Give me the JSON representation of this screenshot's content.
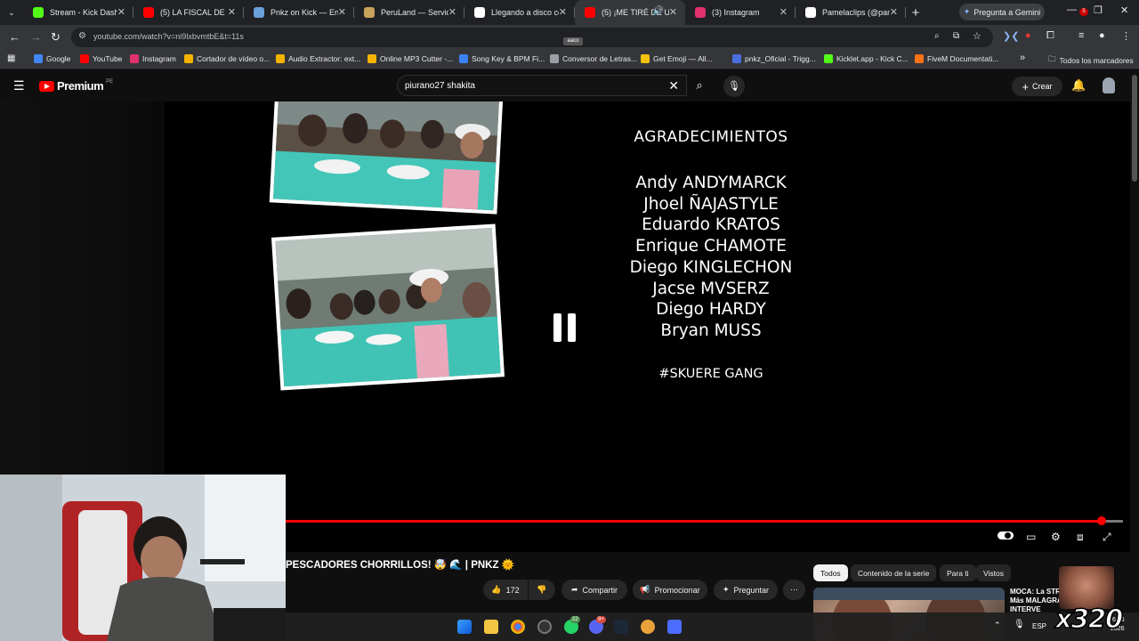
{
  "browser": {
    "tabs": [
      {
        "label": "Stream - Kick Dashbo",
        "fav_color": "#53fc18",
        "icon": "kick-icon"
      },
      {
        "label": "(5) LA FISCAL DE LA N",
        "fav_color": "#ff0000",
        "icon": "youtube-icon"
      },
      {
        "label": "Pnkz on Kick — Enga",
        "fav_color": "#6a9fd8",
        "icon": "kick-app-icon"
      },
      {
        "label": "PeruLand — Servidor",
        "fav_color": "#c9a35b",
        "icon": "peruland-icon"
      },
      {
        "label": "Llegando a disco con",
        "fav_color": "#ffffff",
        "icon": "tiktok-icon"
      },
      {
        "label": "(5) ¡ME TIRÉ DE U",
        "fav_color": "#ff0000",
        "icon": "youtube-icon",
        "active": true
      },
      {
        "label": "(3) Instagram",
        "fav_color": "#e1306c",
        "icon": "instagram-icon"
      },
      {
        "label": "Pamelaclips (@pamel",
        "fav_color": "#ffffff",
        "icon": "tiktok-icon"
      }
    ],
    "new_tab_label": "+",
    "gemini_label": "Pregunta a Gemini",
    "url": "youtube.com/watch?v=ni9lxbvmtbE&t=11s",
    "pip_label": "aaco",
    "bookmarks": [
      {
        "label": "Google",
        "color": "#4285f4"
      },
      {
        "label": "YouTube",
        "color": "#ff0000"
      },
      {
        "label": "Instagram",
        "color": "#e1306c"
      },
      {
        "label": "Cortador de vídeo o...",
        "color": "#f4b400"
      },
      {
        "label": "Audio Extractor: ext...",
        "color": "#f4b400"
      },
      {
        "label": "Online MP3 Cutter -...",
        "color": "#f4b400"
      },
      {
        "label": "Song Key & BPM Fi...",
        "color": "#3b82f6"
      },
      {
        "label": "Conversor de Letras...",
        "color": "#9aa0a6"
      },
      {
        "label": "Get Emoji — All...",
        "color": "#f4c20d"
      },
      {
        "label": "pnkz_Oficial - Trigg...",
        "color": "#4a6ee0"
      },
      {
        "label": "Kicklet.app - Kick C...",
        "color": "#53fc18"
      },
      {
        "label": "FiveM Documentati...",
        "color": "#f97316"
      }
    ],
    "bookmarks_folder": "Todos los marcadores"
  },
  "youtube": {
    "logo_text": "Premium",
    "country_code": "PE",
    "search_value": "piurano27 shakita",
    "create_label": "Crear",
    "notif_count": "5"
  },
  "player": {
    "credits_title": "AGRADECIMIENTOS",
    "credits_names": [
      "Andy ANDYMARCK",
      "Jhoel ÑAJASTYLE",
      "Eduardo KRATOS",
      "Enrique CHAMOTE",
      "Diego KINGLECHON",
      "Jacse MVSERZ",
      "Diego HARDY",
      "Bryan MUSS"
    ],
    "credits_tag": "#SKUERE GANG",
    "progress": 0.975
  },
  "video": {
    "title": "PESCADORES CHORRILLOS! 🤯 🌊 | PNKZ 🌞",
    "likes": "172",
    "share_label": "Compartir",
    "promote_label": "Promocionar",
    "ask_label": "Preguntar"
  },
  "chips": [
    "Todos",
    "Contenido de la serie",
    "Para ti",
    "Vistos"
  ],
  "recommendation": {
    "title": "MOCA: La STR Más MALAGRA INTERVE"
  },
  "overlay": {
    "multiplier": "x320"
  },
  "taskbar": {
    "lang": "ESP",
    "time": "6:16",
    "date": "2026",
    "badge_whatsapp": "22",
    "badge_discord": "9+"
  }
}
